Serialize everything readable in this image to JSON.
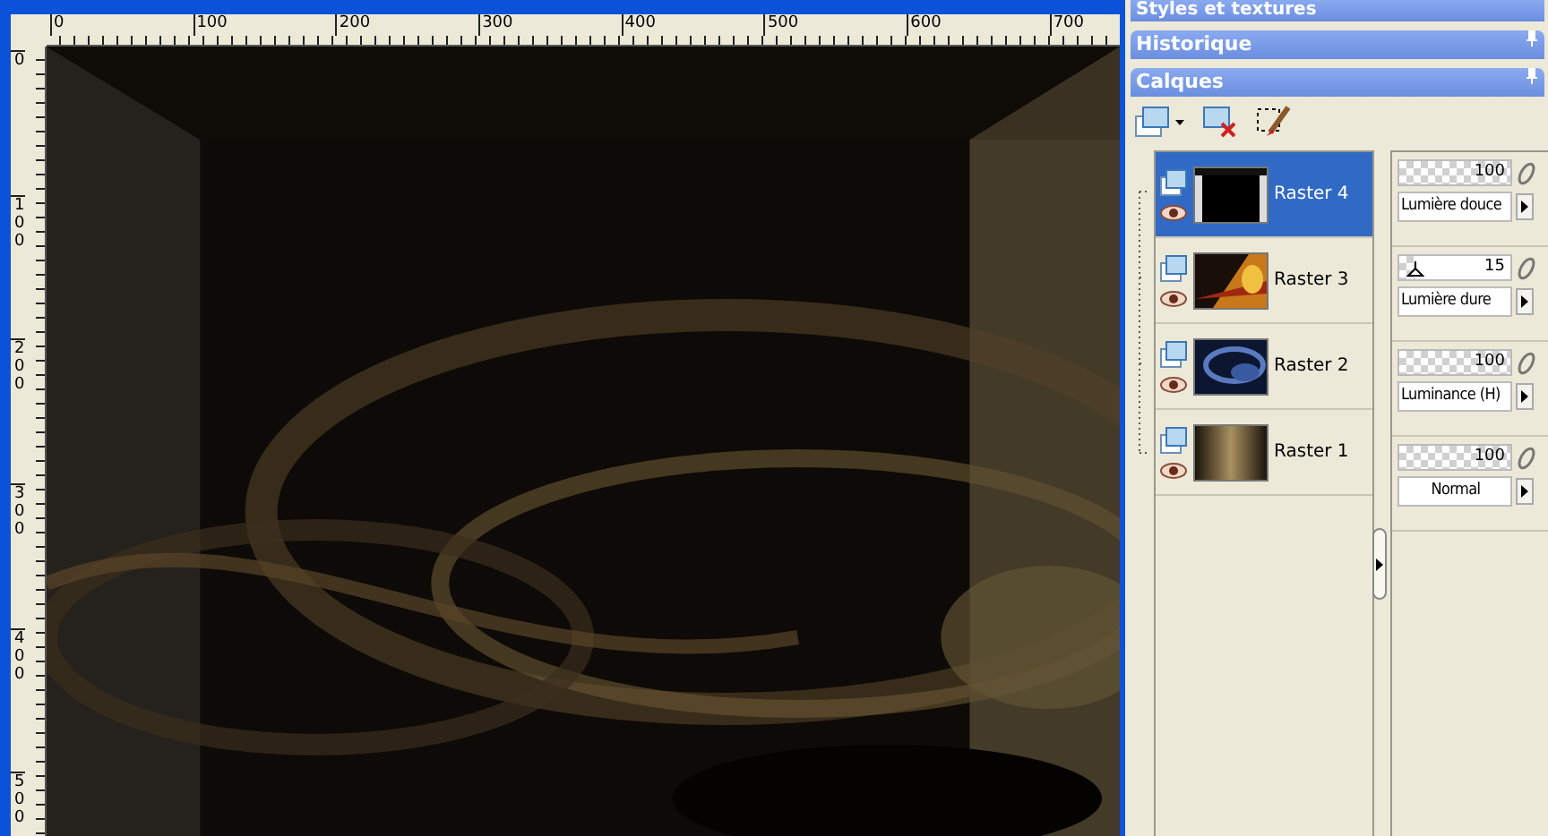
{
  "image_window": {
    "top_ruler": [
      "0",
      "100",
      "200",
      "300",
      "400",
      "500",
      "600",
      "700"
    ],
    "left_ruler": [
      "0",
      "100",
      "200",
      "300",
      "400",
      "500"
    ]
  },
  "panels": [
    {
      "title": "Styles et textures"
    },
    {
      "title": "Historique"
    },
    {
      "title": "Calques"
    }
  ],
  "layers": [
    {
      "name": "Raster 4",
      "selected": true,
      "visible": true,
      "opacity": "100",
      "level": 1,
      "blend_mode": "Lumière douce"
    },
    {
      "name": "Raster 3",
      "selected": false,
      "visible": true,
      "opacity": "15",
      "level": 0.15,
      "blend_mode": "Lumière dure"
    },
    {
      "name": "Raster 2",
      "selected": false,
      "visible": true,
      "opacity": "100",
      "level": 1,
      "blend_mode": "Luminance (H)"
    },
    {
      "name": "Raster 1",
      "selected": false,
      "visible": true,
      "opacity": "100",
      "level": 1,
      "blend_mode": "Normal"
    }
  ]
}
